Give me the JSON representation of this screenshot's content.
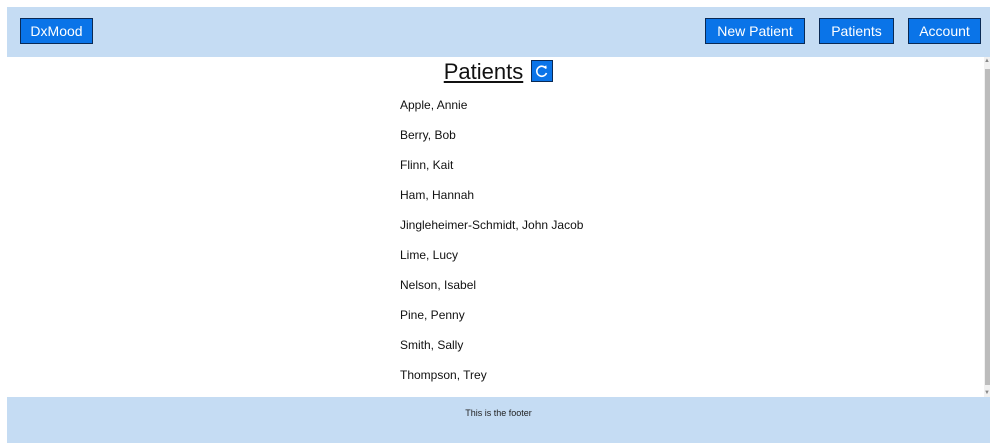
{
  "header": {
    "brand_label": "DxMood",
    "new_patient_label": "New Patient",
    "patients_label": "Patients",
    "account_label": "Account"
  },
  "main": {
    "title": "Patients",
    "refresh_icon": "refresh-icon",
    "patients": [
      "Apple, Annie",
      "Berry, Bob",
      "Flinn, Kait",
      "Ham, Hannah",
      "Jingleheimer-Schmidt, John Jacob",
      "Lime, Lucy",
      "Nelson, Isabel",
      "Pine, Penny",
      "Smith, Sally",
      "Thompson, Trey"
    ]
  },
  "footer": {
    "text": "This is the footer"
  },
  "colors": {
    "bar_background": "#c5dcf3",
    "button_background": "#0a74e8",
    "button_text": "#ffffff"
  }
}
